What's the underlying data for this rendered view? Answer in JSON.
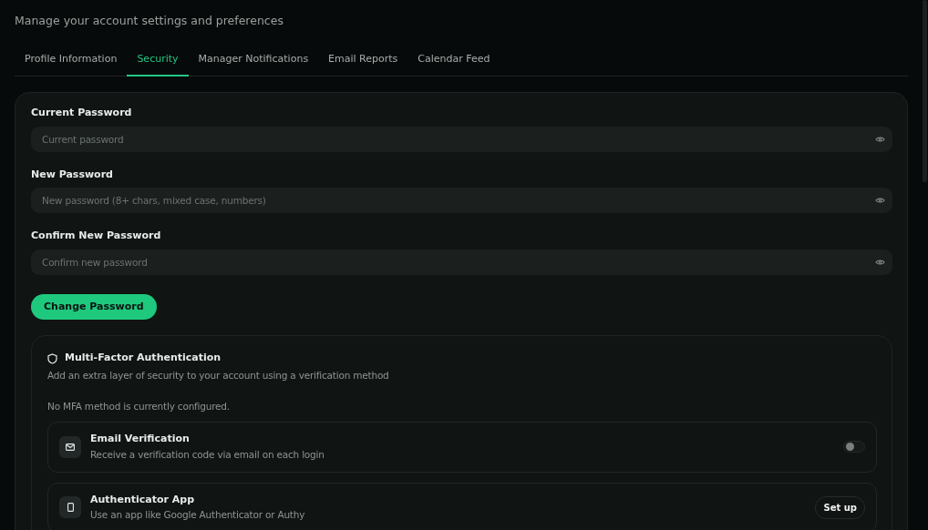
{
  "subtitle": "Manage your account settings and preferences",
  "tabs": [
    {
      "label": "Profile Information",
      "selected": false
    },
    {
      "label": "Security",
      "selected": true
    },
    {
      "label": "Manager Notifications",
      "selected": false
    },
    {
      "label": "Email Reports",
      "selected": false
    },
    {
      "label": "Calendar Feed",
      "selected": false
    }
  ],
  "password_fields": [
    {
      "label": "Current Password",
      "placeholder": "Current password"
    },
    {
      "label": "New Password",
      "placeholder": "New password (8+ chars, mixed case, numbers)"
    },
    {
      "label": "Confirm New Password",
      "placeholder": "Confirm new password"
    }
  ],
  "change_button": "Change Password",
  "mfa": {
    "title": "Multi-Factor Authentication",
    "description": "Add an extra layer of security to your account using a verification method",
    "status": "No MFA method is currently configured.",
    "methods": [
      {
        "kind": "toggle",
        "title": "Email Verification",
        "description": "Receive a verification code via email on each login",
        "on": false
      },
      {
        "kind": "button",
        "title": "Authenticator App",
        "description": "Use an app like Google Authenticator or Authy",
        "button": "Set up"
      }
    ]
  }
}
